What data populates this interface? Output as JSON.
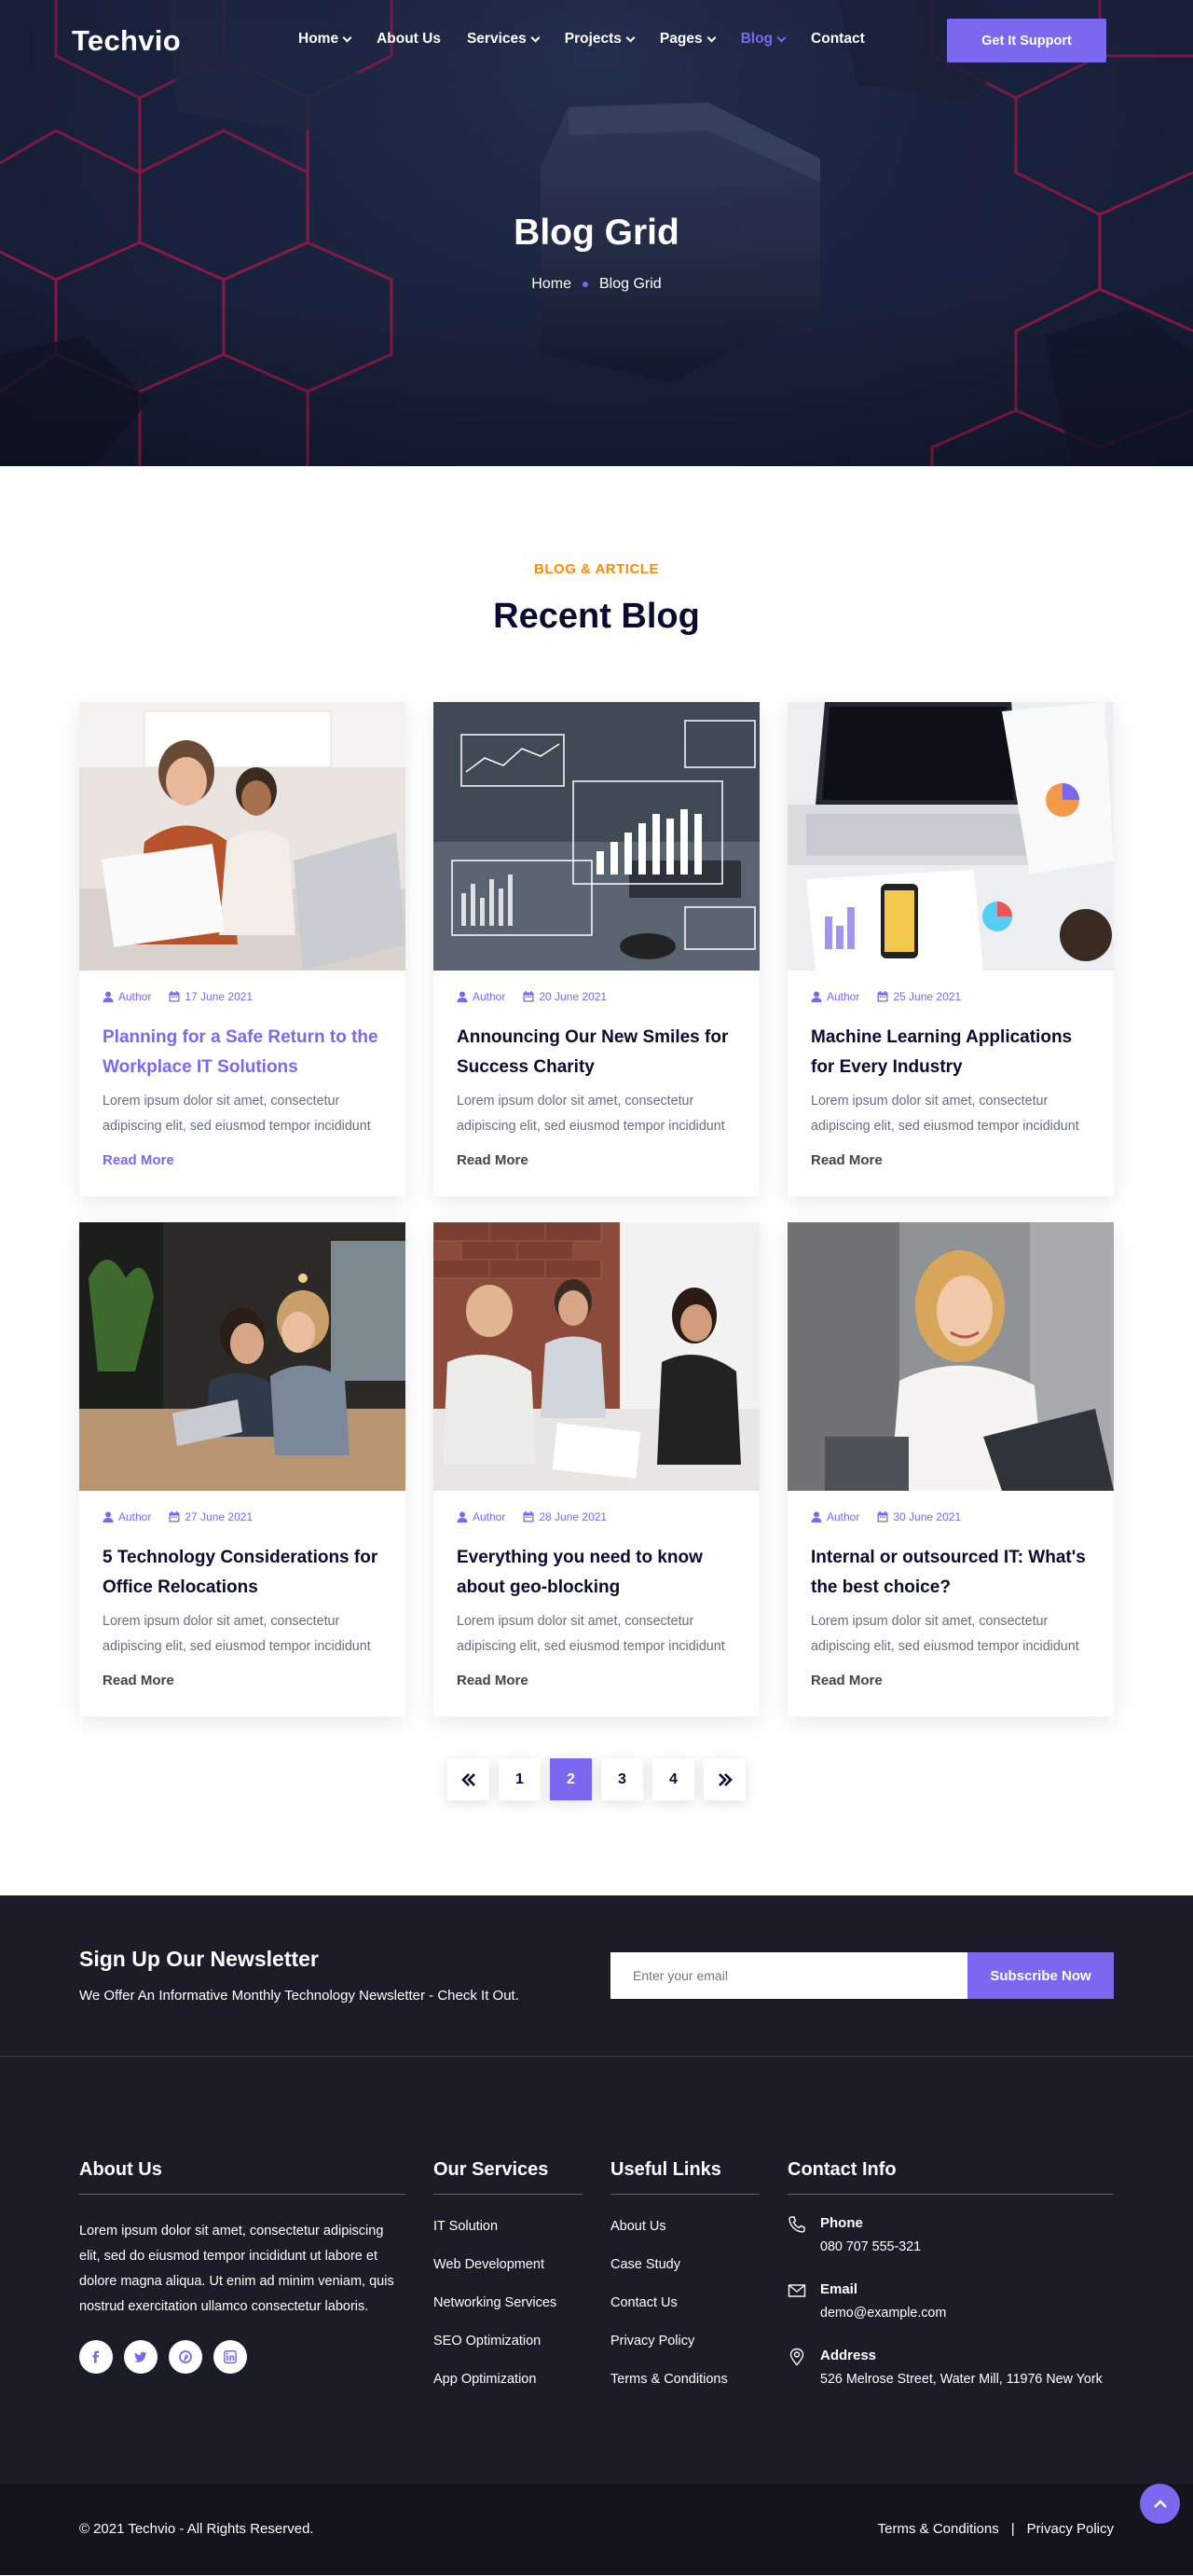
{
  "brand": {
    "name": "Techvio",
    "accent": "#7b68ee",
    "orange": "#ff8b00",
    "dark": "#1b1c27"
  },
  "nav": {
    "items": [
      {
        "label": "Home",
        "dropdown": true,
        "active": false
      },
      {
        "label": "About Us",
        "dropdown": false,
        "active": false
      },
      {
        "label": "Services",
        "dropdown": true,
        "active": false
      },
      {
        "label": "Projects",
        "dropdown": true,
        "active": false
      },
      {
        "label": "Pages",
        "dropdown": true,
        "active": false
      },
      {
        "label": "Blog",
        "dropdown": true,
        "active": true
      },
      {
        "label": "Contact",
        "dropdown": false,
        "active": false
      }
    ],
    "cta": "Get It Support"
  },
  "hero": {
    "title": "Blog Grid",
    "breadcrumb": [
      "Home",
      "Blog Grid"
    ]
  },
  "blog": {
    "subtitle": "BLOG & ARTICLE",
    "title": "Recent Blog",
    "posts": [
      {
        "author": "Author",
        "date": "17 June 2021",
        "title": "Planning for a Safe Return to the Workplace IT Solutions",
        "excerpt": "Lorem ipsum dolor sit amet, consectetur adipiscing elit, sed eiusmod tempor incididunt",
        "read_more": "Read More",
        "highlight": true,
        "image": "woman-and-girl-with-laptop"
      },
      {
        "author": "Author",
        "date": "20 June 2021",
        "title": "Announcing Our New Smiles for Success Charity",
        "excerpt": "Lorem ipsum dolor sit amet, consectetur adipiscing elit, sed eiusmod tempor incididunt",
        "read_more": "Read More",
        "highlight": false,
        "image": "business-analytics-charts"
      },
      {
        "author": "Author",
        "date": "25 June 2021",
        "title": "Machine Learning Applications for Every Industry",
        "excerpt": "Lorem ipsum dolor sit amet, consectetur adipiscing elit, sed eiusmod tempor incididunt",
        "read_more": "Read More",
        "highlight": false,
        "image": "laptop-and-reports-desk"
      },
      {
        "author": "Author",
        "date": "27 June 2021",
        "title": "5 Technology Considerations for Office Relocations",
        "excerpt": "Lorem ipsum dolor sit amet, consectetur adipiscing elit, sed eiusmod tempor incididunt",
        "read_more": "Read More",
        "highlight": false,
        "image": "coworkers-at-laptop"
      },
      {
        "author": "Author",
        "date": "28 June 2021",
        "title": "Everything you need to know about geo-blocking",
        "excerpt": "Lorem ipsum dolor sit amet, consectetur adipiscing elit, sed eiusmod tempor incididunt",
        "read_more": "Read More",
        "highlight": false,
        "image": "team-meeting"
      },
      {
        "author": "Author",
        "date": "30 June 2021",
        "title": "Internal or outsourced IT: What's the best choice?",
        "excerpt": "Lorem ipsum dolor sit amet, consectetur adipiscing elit, sed eiusmod tempor incididunt",
        "read_more": "Read More",
        "highlight": false,
        "image": "smiling-woman-at-computer"
      }
    ],
    "pagination": {
      "prev": "«",
      "pages": [
        "1",
        "2",
        "3",
        "4"
      ],
      "current": "2",
      "next": "»"
    }
  },
  "newsletter": {
    "title": "Sign Up Our Newsletter",
    "text": "We Offer An Informative Monthly Technology Newsletter - Check It Out.",
    "placeholder": "Enter your email",
    "button": "Subscribe Now"
  },
  "footer": {
    "about": {
      "title": "About Us",
      "text": "Lorem ipsum dolor sit amet, consectetur adipiscing elit, sed do eiusmod tempor incididunt ut labore et dolore magna aliqua. Ut enim ad minim veniam, quis nostrud exercitation ullamco consectetur laboris.",
      "socials": [
        "facebook-icon",
        "twitter-icon",
        "pinterest-icon",
        "linkedin-icon"
      ]
    },
    "services": {
      "title": "Our Services",
      "items": [
        "IT Solution",
        "Web Development",
        "Networking Services",
        "SEO Optimization",
        "App Optimization"
      ]
    },
    "links": {
      "title": "Useful Links",
      "items": [
        "About Us",
        "Case Study",
        "Contact Us",
        "Privacy Policy",
        "Terms & Conditions"
      ]
    },
    "contact": {
      "title": "Contact Info",
      "phone_label": "Phone",
      "phone": "080 707 555-321",
      "email_label": "Email",
      "email": "demo@example.com",
      "address_label": "Address",
      "address": "526 Melrose Street, Water Mill, 11976 New York"
    }
  },
  "copyright": {
    "text": "2021 Techvio - All Rights Reserved.",
    "links": [
      "Terms & Conditions",
      "Privacy Policy"
    ],
    "separator": "|"
  }
}
